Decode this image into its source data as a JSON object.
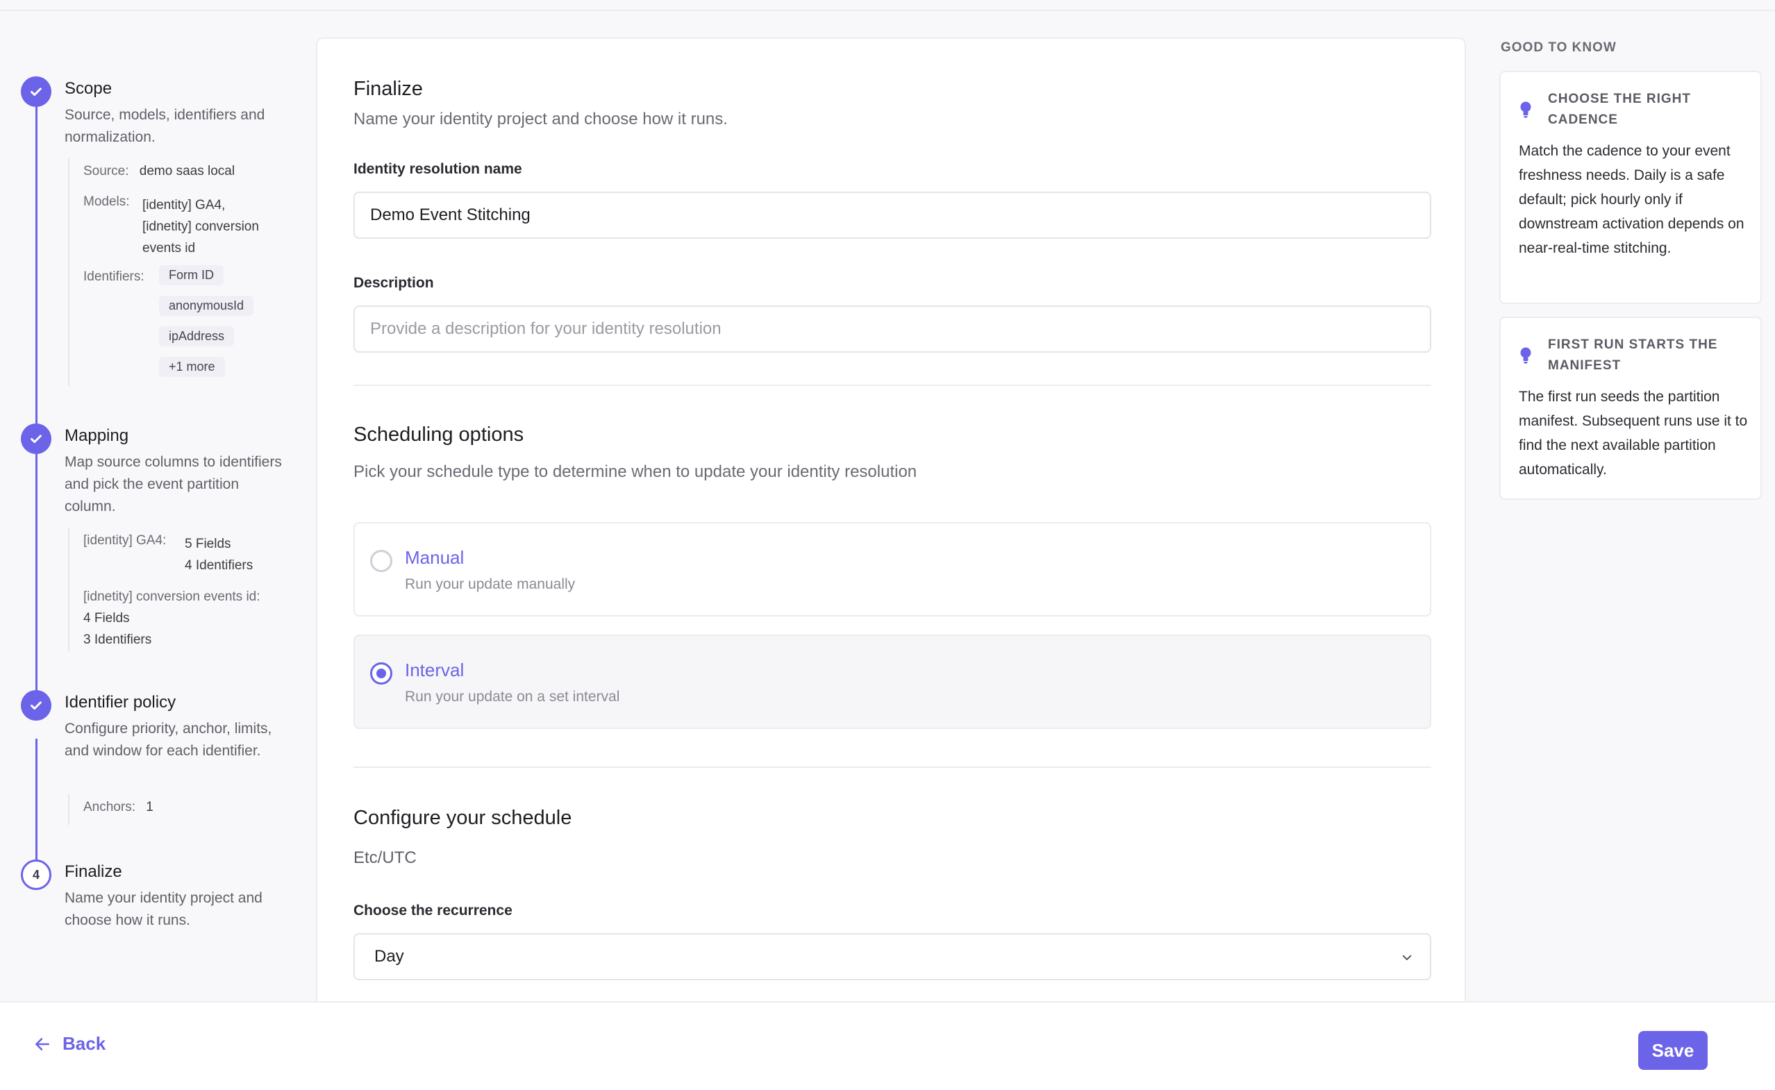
{
  "colors": {
    "accent": "#6b63e8",
    "border": "#ececf0",
    "muted": "#6a6a73"
  },
  "stepper": {
    "steps": [
      {
        "title": "Scope",
        "description": "Source, models, identifiers and normalization.",
        "status": "complete",
        "details": {
          "source_label": "Source:",
          "source_value": "demo saas local",
          "models_label": "Models:",
          "models_value_line1": "[identity] GA4,",
          "models_value_line2": "[idnetity] conversion",
          "models_value_line3": "events id",
          "identifiers_label": "Identifiers:",
          "identifiers": [
            "Form ID",
            "anonymousId",
            "ipAddress",
            "+1 more"
          ]
        }
      },
      {
        "title": "Mapping",
        "description": "Map source columns to identifiers and pick the event partition column.",
        "status": "complete",
        "details": {
          "model1_label": "[identity] GA4:",
          "model1_fields": "5 Fields",
          "model1_identifiers": "4 Identifiers",
          "model2_label": "[idnetity] conversion events id:",
          "model2_fields": "4 Fields",
          "model2_identifiers": "3 Identifiers"
        }
      },
      {
        "title": "Identifier policy",
        "description": "Configure priority, anchor, limits, and window for each identifier.",
        "status": "complete",
        "details": {
          "anchors_label": "Anchors:",
          "anchors_value": "1"
        }
      },
      {
        "title": "Finalize",
        "description": "Name your identity project and choose how it runs.",
        "status": "current",
        "number": "4"
      }
    ]
  },
  "main": {
    "finalize": {
      "title": "Finalize",
      "subtitle": "Name your identity project and choose how it runs.",
      "name_label": "Identity resolution name",
      "name_value": "Demo Event Stitching",
      "description_label": "Description",
      "description_placeholder": "Provide a description for your identity resolution"
    },
    "scheduling": {
      "title": "Scheduling options",
      "subtitle": "Pick your schedule type to determine when to update your identity resolution",
      "options": [
        {
          "title": "Manual",
          "description": "Run your update manually",
          "selected": false
        },
        {
          "title": "Interval",
          "description": "Run your update on a set interval",
          "selected": true
        }
      ]
    },
    "configure": {
      "title": "Configure your schedule",
      "timezone": "Etc/UTC",
      "recurrence_label": "Choose the recurrence",
      "recurrence_value": "Day"
    }
  },
  "tips": {
    "heading": "GOOD TO KNOW",
    "items": [
      {
        "icon": "lightbulb-icon",
        "title": "CHOOSE THE RIGHT CADENCE",
        "body": "Match the cadence to your event freshness needs. Daily is a safe default; pick hourly only if downstream activation depends on near-real-time stitching."
      },
      {
        "icon": "lightbulb-icon",
        "title": "FIRST RUN STARTS THE MANIFEST",
        "body": "The first run seeds the partition manifest. Subsequent runs use it to find the next available partition automatically."
      }
    ]
  },
  "footer": {
    "back_label": "Back",
    "save_label": "Save"
  }
}
